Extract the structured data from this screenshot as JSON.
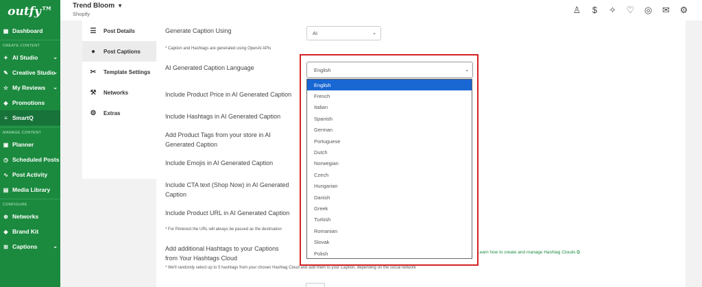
{
  "sidebar": {
    "logo": "outfy™",
    "items": [
      {
        "label": "Dashboard",
        "icon": "dashboard-icon"
      },
      {
        "label": "AI Studio",
        "icon": "ai-icon"
      },
      {
        "label": "Creative Studio",
        "icon": "palette-icon"
      },
      {
        "label": "My Reviews",
        "icon": "reviews-icon"
      },
      {
        "label": "Promotions",
        "icon": "promotions-icon"
      },
      {
        "label": "SmartQ",
        "icon": "queue-icon"
      },
      {
        "label": "Planner",
        "icon": "calendar-icon"
      },
      {
        "label": "Scheduled Posts",
        "icon": "clock-icon"
      },
      {
        "label": "Post Activity",
        "icon": "activity-icon"
      },
      {
        "label": "Media Library",
        "icon": "media-icon"
      },
      {
        "label": "Networks",
        "icon": "networks-icon"
      },
      {
        "label": "Brand Kit",
        "icon": "brand-icon"
      },
      {
        "label": "Captions",
        "icon": "captions-icon"
      }
    ],
    "sections": {
      "create": "CREATE CONTENT",
      "manage": "MANAGE CONTENT",
      "configure": "CONFIGURE"
    }
  },
  "topbar": {
    "store_name": "Trend Bloom",
    "platform": "Shopify",
    "icons": [
      "user-icon",
      "billing-icon",
      "magic-icon",
      "handshake-icon",
      "support-icon",
      "mail-icon",
      "settings-icon"
    ]
  },
  "tabs": [
    {
      "label": "Post Details",
      "icon": "sliders-icon"
    },
    {
      "label": "Post Captions",
      "icon": "ai-head-icon"
    },
    {
      "label": "Template Settings",
      "icon": "tools-icon"
    },
    {
      "label": "Networks",
      "icon": "wrench-icon"
    },
    {
      "label": "Extras",
      "icon": "gear-icon"
    }
  ],
  "form": {
    "generate_caption_label": "Generate Caption Using",
    "generate_caption_value": "AI",
    "openai_note": "* Caption and Hashtags are generated using OpenAI APIs",
    "language_label": "AI Generated Caption Language",
    "language_value": "English",
    "include_price_label": "Include Product Price in AI Generated Caption",
    "include_hashtags_label": "Include Hashtags in AI Generated Caption",
    "add_tags_label_1": "Add Product Tags from your store in AI",
    "add_tags_label_2": "Generated Caption",
    "include_emojis_label": "Include Emojis in AI Generated Caption",
    "include_cta_label_1": "Include CTA text (Shop Now) in AI Generated",
    "include_cta_label_2": "Caption",
    "include_url_label": "Include Product URL in AI Generated Caption",
    "pinterest_note": "* For Pinterest the URL will always be passed as the destination",
    "additional_hashtags_label_1": "Add additional Hashtags to your Captions",
    "additional_hashtags_label_2": "from Your Hashtags Cloud",
    "hashtag_note": "* We'll randomly select up to 5 hashtags from your chosen Hashtag Cloud and add them to your Caption, depending on the social network",
    "hashtag_link": "Learn how to create and manage Hashtag Clouds"
  },
  "language_options": [
    "English",
    "French",
    "Italian",
    "Spanish",
    "German",
    "Portuguese",
    "Dutch",
    "Norwegian",
    "Czech",
    "Hungarian",
    "Danish",
    "Greek",
    "Turkish",
    "Romanian",
    "Slovak",
    "Polish"
  ],
  "colors": {
    "sidebar_bg": "#1b8a3e",
    "highlight_border": "#d32020",
    "selected_option": "#1967d2",
    "link": "#1b8a3e"
  }
}
